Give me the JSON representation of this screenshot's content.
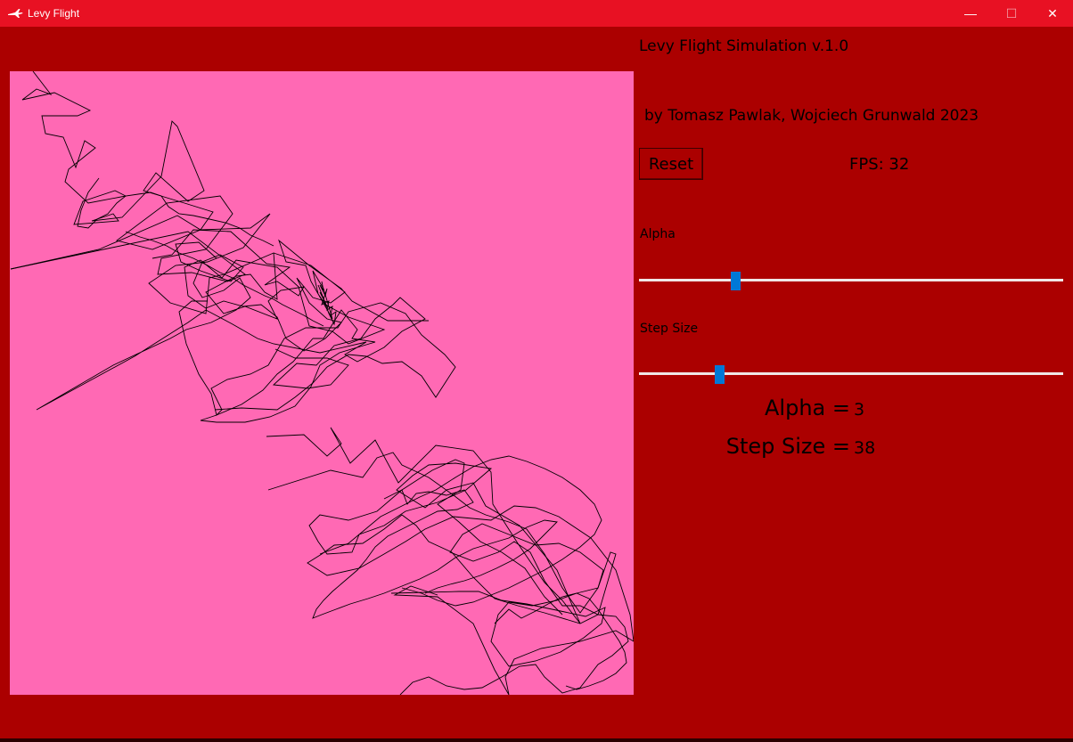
{
  "window": {
    "title": "Levy Flight",
    "buttons": {
      "minimize": "—",
      "maximize": "☐",
      "close": "✕"
    }
  },
  "panel": {
    "heading": "Levy Flight Simulation v.1.0",
    "authors": "by Tomasz Pawlak, Wojciech Grunwald 2023",
    "reset_label": "Reset",
    "fps_text": "FPS: 32",
    "alpha_label": "Alpha",
    "step_label": "Step Size",
    "alpha_slider_fraction": 0.226,
    "step_slider_fraction": 0.189,
    "alpha_readout_label": "Alpha =",
    "alpha_readout_value": "3",
    "step_readout_label": "Step Size =",
    "step_readout_value": "38"
  },
  "colors": {
    "titlebar": "#e81123",
    "background": "#ab0000",
    "canvas": "#ff69b4",
    "path": "#000000",
    "slider_thumb": "#0078d7"
  },
  "icons": {
    "app": "airplane-icon",
    "minimize": "minimize-icon",
    "maximize": "maximize-icon",
    "close": "close-icon"
  }
}
